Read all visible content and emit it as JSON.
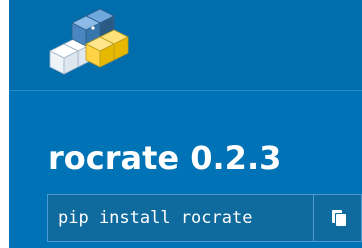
{
  "header": {
    "logo_icon": "python-cubes-logo"
  },
  "package": {
    "title": "rocrate 0.2.3",
    "pip_command": "pip install rocrate",
    "copy_icon": "copy-icon"
  },
  "colors": {
    "header_bg": "#006dad",
    "banner_bg": "#0073b7",
    "pip_box_bg": "#0f6a9e",
    "python_yellow": "#ffd343",
    "python_blue": "#3776ab"
  }
}
